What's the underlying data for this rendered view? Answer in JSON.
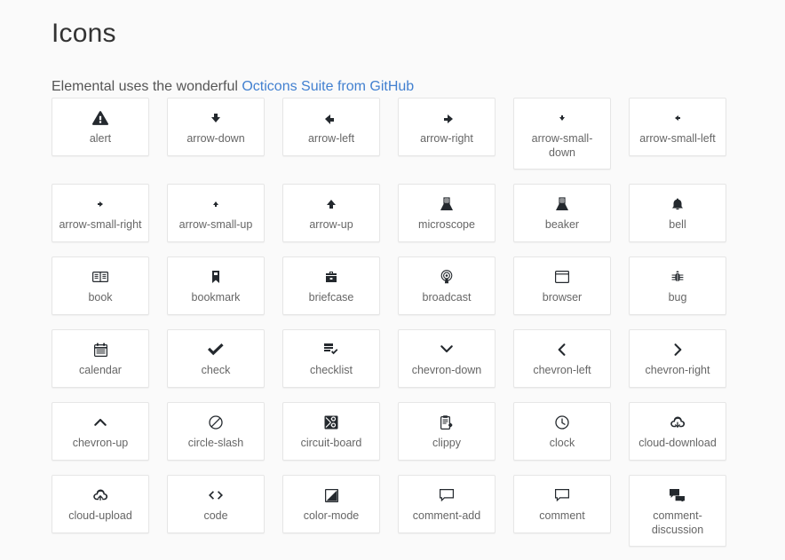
{
  "header": {
    "title": "Icons",
    "subtitle_prefix": "Elemental uses the wonderful ",
    "subtitle_link": "Octicons Suite from GitHub",
    "link_color": "#4280d0",
    "title_color": "#333333",
    "page_background": "#fafafa",
    "card_background": "#ffffff",
    "card_border": "#e6e6e6",
    "label_color": "#666666",
    "glyph_color": "#24292e"
  },
  "grid": {
    "columns": 6,
    "icons": [
      {
        "name": "alert",
        "label": "alert",
        "icon": "alert-icon"
      },
      {
        "name": "arrow-down",
        "label": "arrow-down",
        "icon": "arrow-down-icon"
      },
      {
        "name": "arrow-left",
        "label": "arrow-left",
        "icon": "arrow-left-icon"
      },
      {
        "name": "arrow-right",
        "label": "arrow-right",
        "icon": "arrow-right-icon"
      },
      {
        "name": "arrow-small-down",
        "label": "arrow-small-down",
        "icon": "arrow-small-down-icon"
      },
      {
        "name": "arrow-small-left",
        "label": "arrow-small-left",
        "icon": "arrow-small-left-icon"
      },
      {
        "name": "arrow-small-right",
        "label": "arrow-small-right",
        "icon": "arrow-small-right-icon"
      },
      {
        "name": "arrow-small-up",
        "label": "arrow-small-up",
        "icon": "arrow-small-up-icon"
      },
      {
        "name": "arrow-up",
        "label": "arrow-up",
        "icon": "arrow-up-icon"
      },
      {
        "name": "microscope",
        "label": "microscope",
        "icon": "microscope-icon"
      },
      {
        "name": "beaker",
        "label": "beaker",
        "icon": "beaker-icon"
      },
      {
        "name": "bell",
        "label": "bell",
        "icon": "bell-icon"
      },
      {
        "name": "book",
        "label": "book",
        "icon": "book-icon"
      },
      {
        "name": "bookmark",
        "label": "bookmark",
        "icon": "bookmark-icon"
      },
      {
        "name": "briefcase",
        "label": "briefcase",
        "icon": "briefcase-icon"
      },
      {
        "name": "broadcast",
        "label": "broadcast",
        "icon": "broadcast-icon"
      },
      {
        "name": "browser",
        "label": "browser",
        "icon": "browser-icon"
      },
      {
        "name": "bug",
        "label": "bug",
        "icon": "bug-icon"
      },
      {
        "name": "calendar",
        "label": "calendar",
        "icon": "calendar-icon"
      },
      {
        "name": "check",
        "label": "check",
        "icon": "check-icon"
      },
      {
        "name": "checklist",
        "label": "checklist",
        "icon": "checklist-icon"
      },
      {
        "name": "chevron-down",
        "label": "chevron-down",
        "icon": "chevron-down-icon"
      },
      {
        "name": "chevron-left",
        "label": "chevron-left",
        "icon": "chevron-left-icon"
      },
      {
        "name": "chevron-right",
        "label": "chevron-right",
        "icon": "chevron-right-icon"
      },
      {
        "name": "chevron-up",
        "label": "chevron-up",
        "icon": "chevron-up-icon"
      },
      {
        "name": "circle-slash",
        "label": "circle-slash",
        "icon": "circle-slash-icon"
      },
      {
        "name": "circuit-board",
        "label": "circuit-board",
        "icon": "circuit-board-icon"
      },
      {
        "name": "clippy",
        "label": "clippy",
        "icon": "clippy-icon"
      },
      {
        "name": "clock",
        "label": "clock",
        "icon": "clock-icon"
      },
      {
        "name": "cloud-download",
        "label": "cloud-download",
        "icon": "cloud-download-icon"
      },
      {
        "name": "cloud-upload",
        "label": "cloud-upload",
        "icon": "cloud-upload-icon"
      },
      {
        "name": "code",
        "label": "code",
        "icon": "code-icon"
      },
      {
        "name": "color-mode",
        "label": "color-mode",
        "icon": "color-mode-icon"
      },
      {
        "name": "comment-add",
        "label": "comment-add",
        "icon": "comment-add-icon"
      },
      {
        "name": "comment",
        "label": "comment",
        "icon": "comment-icon"
      },
      {
        "name": "comment-discussion",
        "label": "comment-discussion",
        "icon": "comment-discussion-icon"
      }
    ]
  }
}
